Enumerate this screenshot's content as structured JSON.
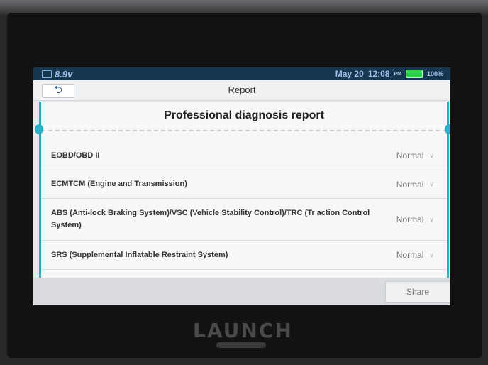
{
  "statusbar": {
    "voltage": "8.9v",
    "date": "May 20",
    "time": "12:08",
    "time_suffix": "PM",
    "battery": "100%"
  },
  "titlebar": {
    "title": "Report"
  },
  "report": {
    "heading": "Professional diagnosis report",
    "rows": [
      {
        "label": "EOBD/OBD II",
        "value": "Normal"
      },
      {
        "label": "ECMTCM (Engine and Transmission)",
        "value": "Normal"
      },
      {
        "label": "ABS (Anti-lock Braking System)/VSC (Vehicle Stability Control)/TRC (Tr action Control System)",
        "value": "Normal"
      },
      {
        "label": "SRS (Supplemental Inflatable Restraint System)",
        "value": "Normal"
      }
    ]
  },
  "footer": {
    "share_label": "Share"
  },
  "device": {
    "brand": "LAUNCH"
  },
  "colors": {
    "accent": "#2bb0c6",
    "status_bar": "#17364f",
    "battery": "#2fd24a"
  },
  "icons": {
    "back": "back-arrow-icon",
    "voltage": "battery-voltage-icon",
    "chevron": "chevron-down-icon"
  }
}
